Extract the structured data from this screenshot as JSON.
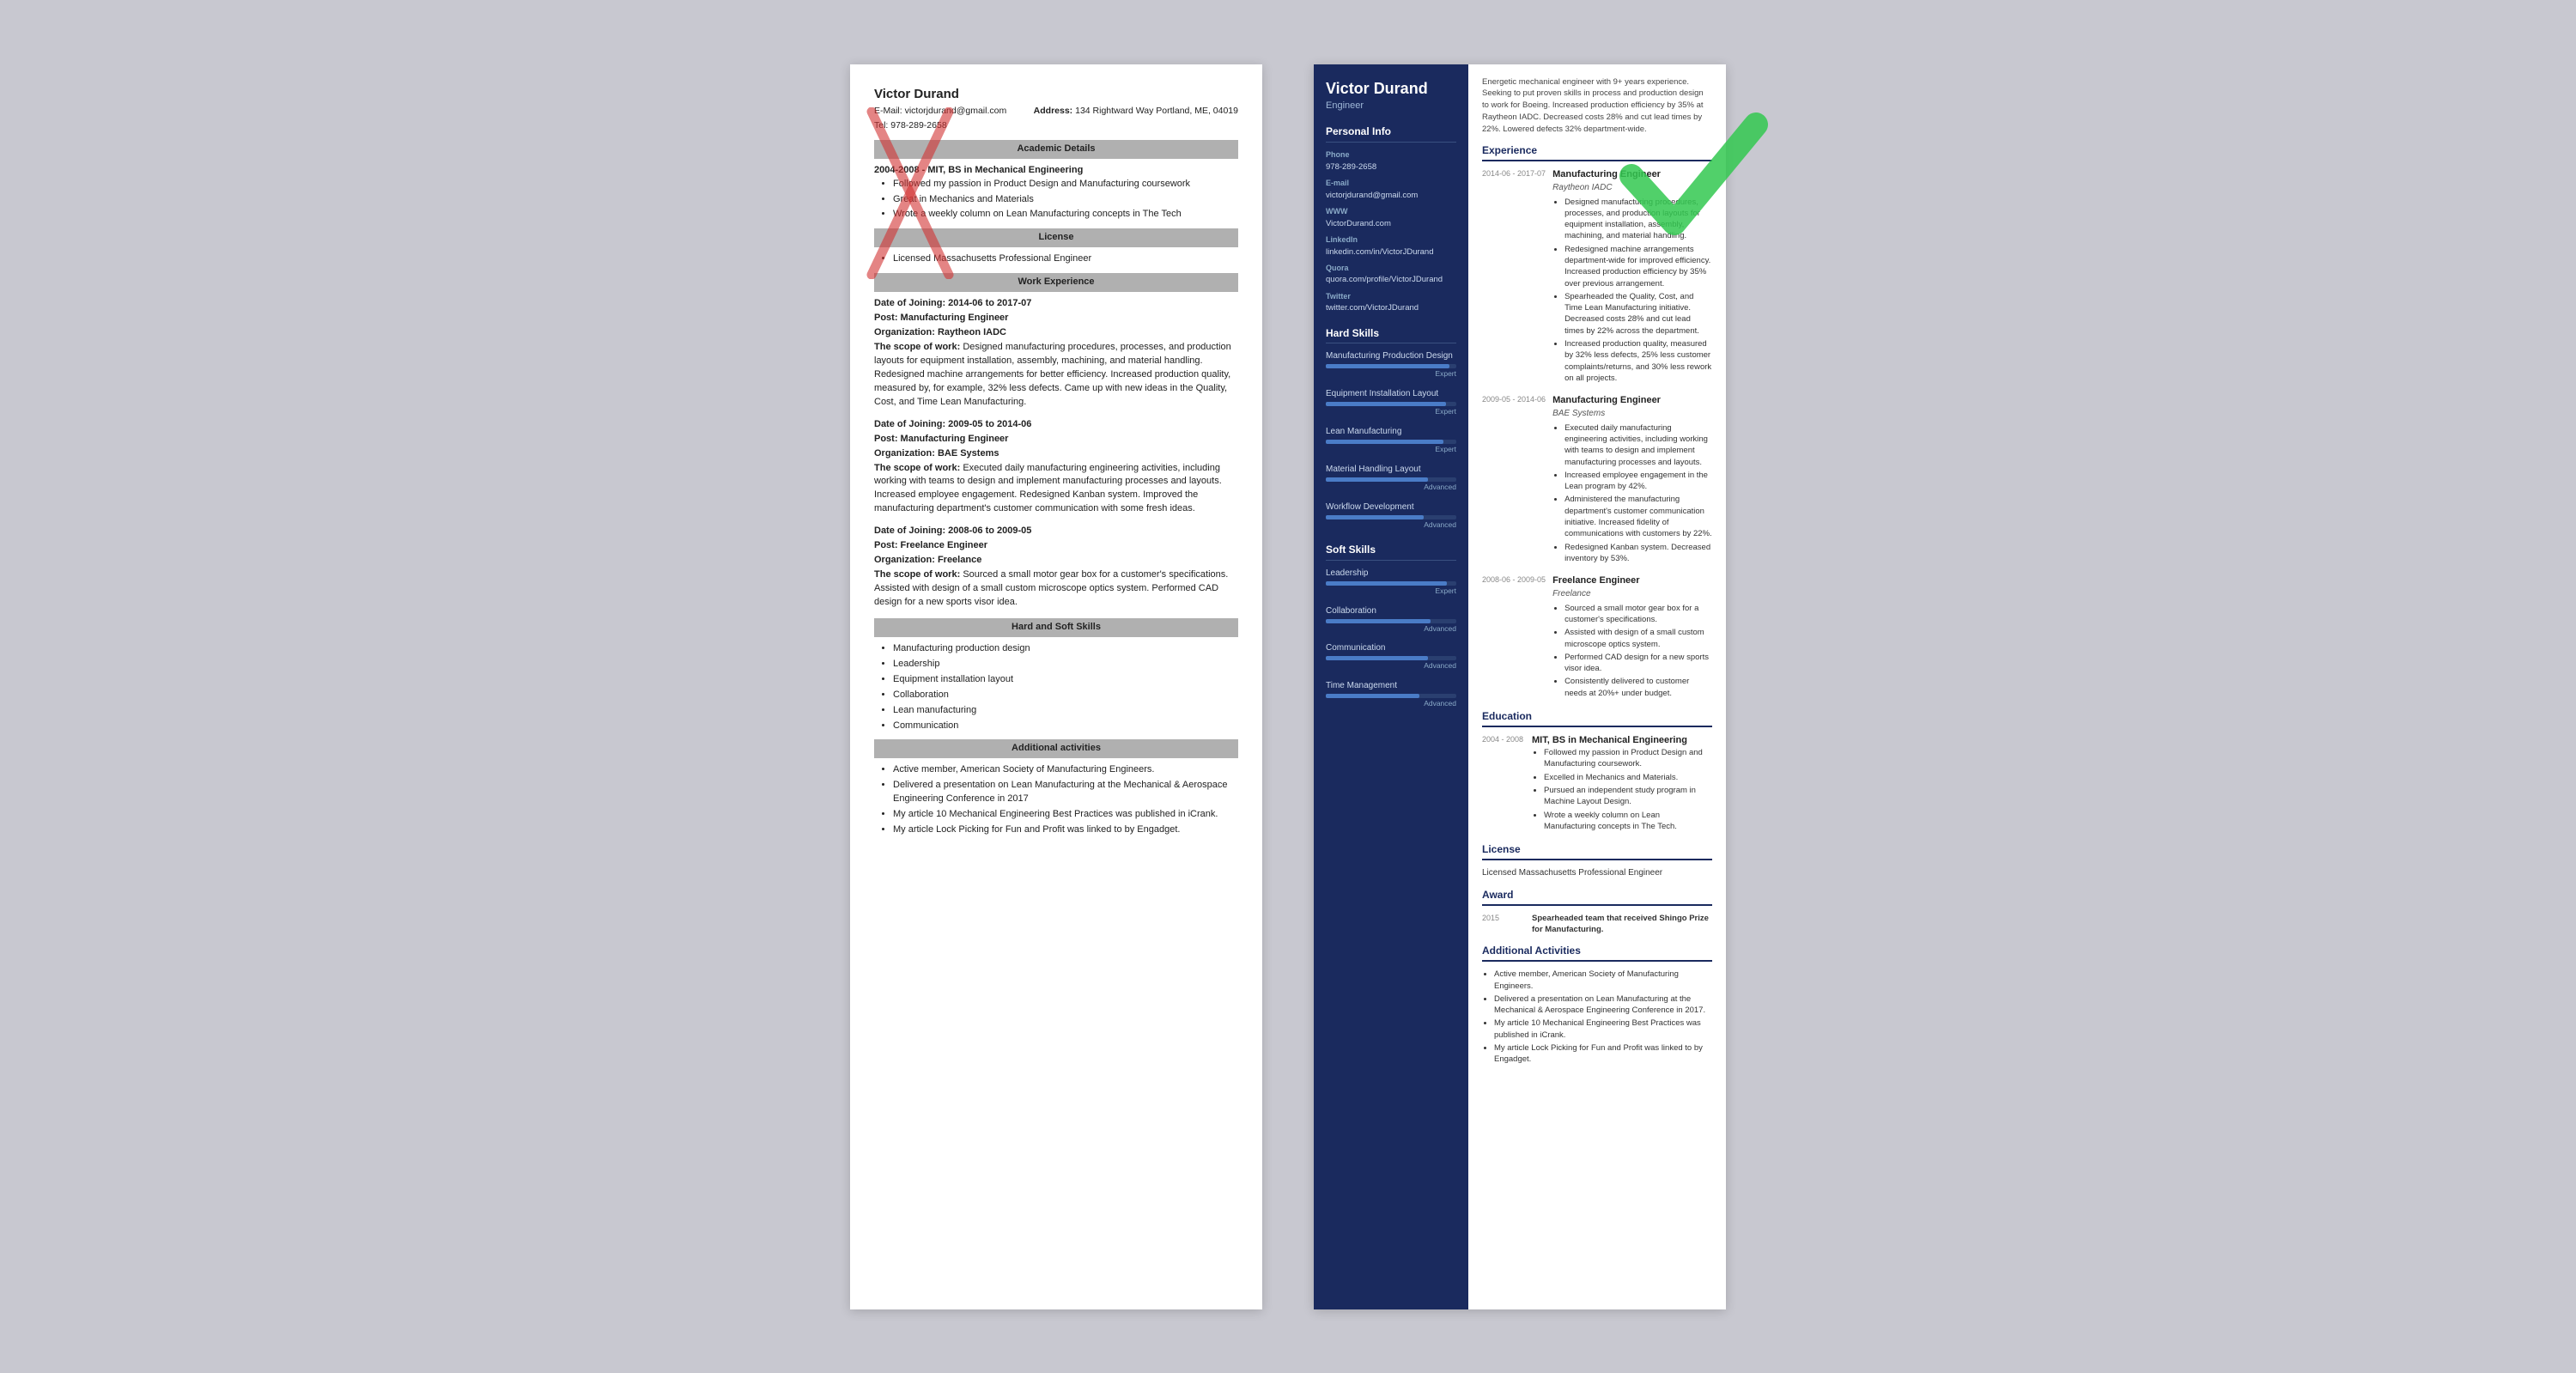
{
  "left_resume": {
    "name": "Victor Durand",
    "email_label": "E-Mail:",
    "email": "victorjdurand@gmail.com",
    "address_label": "Address:",
    "address": "134 Rightward Way Portland, ME, 04019",
    "tel_label": "Tel:",
    "tel": "978-289-2658",
    "sections": {
      "academic": {
        "title": "Academic Details",
        "degree": "2004-2008 - MIT, BS in Mechanical Engineering",
        "bullets": [
          "Followed my passion in Product Design and Manufacturing coursework",
          "Great in Mechanics and Materials",
          "Wrote a weekly column on Lean Manufacturing concepts in The Tech"
        ]
      },
      "license": {
        "title": "License",
        "bullets": [
          "Licensed Massachusetts Professional Engineer"
        ]
      },
      "work": {
        "title": "Work Experience",
        "entries": [
          {
            "dates": "Date of Joining: 2014-06 to 2017-07",
            "post": "Post: Manufacturing Engineer",
            "org": "Organization: Raytheon IADC",
            "scope_label": "The scope of work:",
            "scope": "Designed manufacturing procedures, processes, and production layouts for equipment installation, assembly, machining, and material handling. Redesigned machine arrangements for better efficiency. Increased production quality, measured by, for example, 32% less defects. Came up with new ideas in the Quality, Cost, and Time Lean Manufacturing."
          },
          {
            "dates": "Date of Joining: 2009-05 to 2014-06",
            "post": "Post: Manufacturing Engineer",
            "org": "Organization: BAE Systems",
            "scope_label": "The scope of work:",
            "scope": "Executed daily manufacturing engineering activities, including working with teams to design and implement manufacturing processes and layouts. Increased employee engagement. Redesigned Kanban system. Improved the manufacturing department's customer communication with some fresh ideas."
          },
          {
            "dates": "Date of Joining: 2008-06 to 2009-05",
            "post": "Post: Freelance Engineer",
            "org": "Organization: Freelance",
            "scope_label": "The scope of work:",
            "scope": "Sourced a small motor gear box for a customer's specifications. Assisted with design of a small custom microscope optics system. Performed CAD design for a new sports visor idea."
          }
        ]
      },
      "skills": {
        "title": "Hard and Soft Skills",
        "bullets": [
          "Manufacturing production design",
          "Leadership",
          "Equipment installation layout",
          "Collaboration",
          "Lean manufacturing",
          "Communication"
        ]
      },
      "activities": {
        "title": "Additional activities",
        "bullets": [
          "Active member, American Society of Manufacturing Engineers.",
          "Delivered a presentation on Lean Manufacturing at the Mechanical & Aerospace Engineering Conference in 2017",
          "My article 10 Mechanical Engineering Best Practices was published in iCrank.",
          "My article Lock Picking for Fun and Profit was linked to by Engadget."
        ]
      }
    }
  },
  "right_resume": {
    "name": "Victor Durand",
    "title": "Engineer",
    "summary": "Energetic mechanical engineer with 9+ years experience. Seeking to put proven skills in process and production design to work for Boeing. Increased production efficiency by 35% at Raytheon IADC. Decreased costs 28% and cut lead times by 22%. Lowered defects 32% department-wide.",
    "sidebar": {
      "personal_info_title": "Personal Info",
      "phone_label": "Phone",
      "phone": "978-289-2658",
      "email_label": "E-mail",
      "email": "victorjdurand@gmail.com",
      "www_label": "WWW",
      "www": "VictorDurand.com",
      "linkedin_label": "LinkedIn",
      "linkedin": "linkedin.com/in/VictorJDurand",
      "quora_label": "Quora",
      "quora": "quora.com/profile/VictorJDurand",
      "twitter_label": "Twitter",
      "twitter": "twitter.com/VictorJDurand",
      "hard_skills_title": "Hard Skills",
      "hard_skills": [
        {
          "name": "Manufacturing Production Design",
          "level": "Expert",
          "pct": 95
        },
        {
          "name": "Equipment Installation Layout",
          "level": "Expert",
          "pct": 92
        },
        {
          "name": "Lean Manufacturing",
          "level": "Expert",
          "pct": 90
        },
        {
          "name": "Material Handling Layout",
          "level": "Advanced",
          "pct": 78
        },
        {
          "name": "Workflow Development",
          "level": "Advanced",
          "pct": 75
        }
      ],
      "soft_skills_title": "Soft Skills",
      "soft_skills": [
        {
          "name": "Leadership",
          "level": "Expert",
          "pct": 93
        },
        {
          "name": "Collaboration",
          "level": "Advanced",
          "pct": 80
        },
        {
          "name": "Communication",
          "level": "Advanced",
          "pct": 78
        },
        {
          "name": "Time Management",
          "level": "Advanced",
          "pct": 72
        }
      ]
    },
    "experience": {
      "title": "Experience",
      "entries": [
        {
          "date": "2014-06 - 2017-07",
          "job_title": "Manufacturing Engineer",
          "org": "Raytheon IADC",
          "bullets": [
            "Designed manufacturing procedures, processes, and production layouts for equipment installation, assembly, machining, and material handling.",
            "Redesigned machine arrangements department-wide for improved efficiency. Increased production efficiency by 35% over previous arrangement.",
            "Spearheaded the Quality, Cost, and Time Lean Manufacturing initiative. Decreased costs 28% and cut lead times by 22% across the department.",
            "Increased production quality, measured by 32% less defects, 25% less customer complaints/returns, and 30% less rework on all projects."
          ]
        },
        {
          "date": "2009-05 - 2014-06",
          "job_title": "Manufacturing Engineer",
          "org": "BAE Systems",
          "bullets": [
            "Executed daily manufacturing engineering activities, including working with teams to design and implement manufacturing processes and layouts.",
            "Increased employee engagement in the Lean program by 42%.",
            "Administered the manufacturing department's customer communication initiative. Increased fidelity of communications with customers by 22%.",
            "Redesigned Kanban system. Decreased inventory by 53%."
          ]
        },
        {
          "date": "2008-06 - 2009-05",
          "job_title": "Freelance Engineer",
          "org": "Freelance",
          "bullets": [
            "Sourced a small motor gear box for a customer's specifications.",
            "Assisted with design of a small custom microscope optics system.",
            "Performed CAD design for a new sports visor idea.",
            "Consistently delivered to customer needs at 20%+ under budget."
          ]
        }
      ]
    },
    "education": {
      "title": "Education",
      "entries": [
        {
          "date": "2004 - 2008",
          "degree": "MIT, BS in Mechanical Engineering",
          "bullets": [
            "Followed my passion in Product Design and Manufacturing coursework.",
            "Excelled in Mechanics and Materials.",
            "Pursued an independent study program in Machine Layout Design.",
            "Wrote a weekly column on Lean Manufacturing concepts in The Tech."
          ]
        }
      ]
    },
    "license": {
      "title": "License",
      "text": "Licensed Massachusetts Professional Engineer"
    },
    "award": {
      "title": "Award",
      "year": "2015",
      "text": "Spearheaded team that received Shingo Prize for Manufacturing."
    },
    "additional": {
      "title": "Additional Activities",
      "bullets": [
        "Active member, American Society of Manufacturing Engineers.",
        "Delivered a presentation on Lean Manufacturing at the Mechanical & Aerospace Engineering Conference in 2017.",
        "My article 10 Mechanical Engineering Best Practices was published in iCrank.",
        "My article Lock Picking for Fun and Profit was linked to by Engadget."
      ]
    }
  }
}
